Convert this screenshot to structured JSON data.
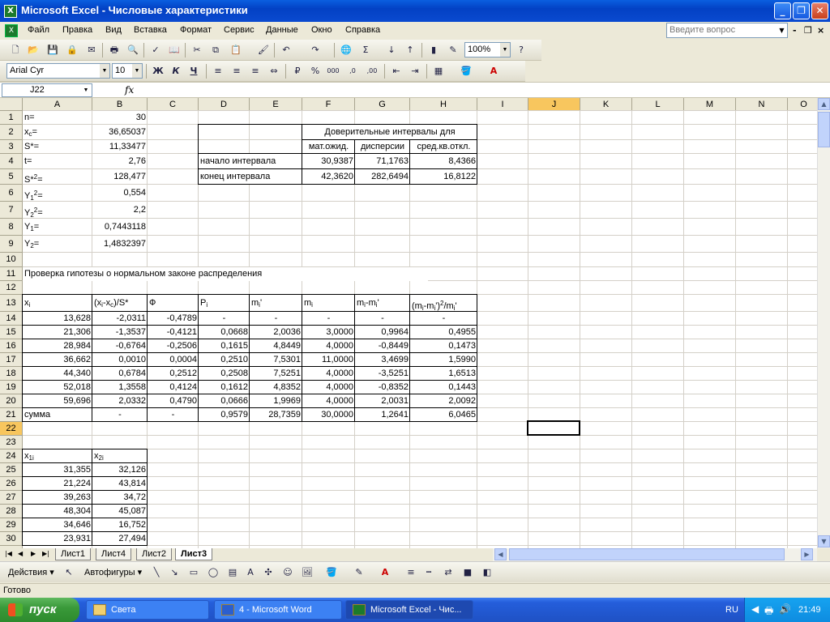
{
  "window": {
    "title": "Microsoft Excel - Числовые характеристики"
  },
  "menu": {
    "items": [
      "Файл",
      "Правка",
      "Вид",
      "Вставка",
      "Формат",
      "Сервис",
      "Данные",
      "Окно",
      "Справка"
    ],
    "ask_placeholder": "Введите вопрос"
  },
  "toolbar": {
    "zoom": "100%",
    "font": "Arial Cyr",
    "size": "10"
  },
  "formula": {
    "cell_ref": "J22",
    "fx": "fx"
  },
  "columns": [
    "A",
    "B",
    "C",
    "D",
    "E",
    "F",
    "G",
    "H",
    "I",
    "J",
    "K",
    "L",
    "M",
    "N",
    "O"
  ],
  "selected_col": "J",
  "selected_row": "22",
  "sheet": {
    "a1": "n=",
    "b1": "30",
    "a2": "x",
    "a2_sub": "c",
    "a2_end": "=",
    "b2": "36,65037",
    "a3": "S*=",
    "b3": "11,33477",
    "a4": "t=",
    "b4": "2,76",
    "a5": "S*",
    "a5_sup": "2",
    "a5_end": "=",
    "b5": "128,477",
    "a6": "Y",
    "a6_sub": "1",
    "a6_sup": "2",
    "a6_end": "=",
    "b6": "0,554",
    "a7": "Y",
    "a7_sub": "2",
    "a7_sup": "2",
    "a7_end": "=",
    "b7": "2,2",
    "a8": "Y",
    "a8_sub": "1",
    "a8_end": "=",
    "b8": "0,7443118",
    "a9": "Y",
    "a9_sub": "2",
    "a9_end": "=",
    "b9": "1,4832397",
    "a11": "Проверка гипотезы о нормальном законе распределения",
    "ci_title": "Доверительные интервалы для",
    "ci_headers": [
      "мат.ожид.",
      "дисперсии",
      "сред.кв.откл."
    ],
    "ci_rows": [
      {
        "label": "начало интервала",
        "values": [
          "30,9387",
          "71,1763",
          "8,4366"
        ]
      },
      {
        "label": "конец интервала",
        "values": [
          "42,3620",
          "282,6494",
          "16,8122"
        ]
      }
    ],
    "hyp_headers": {
      "a": "x",
      "a_sub": "i",
      "b1": "(x",
      "b_sub1": "i",
      "b2": "-x",
      "b_sub2": "c",
      "b3": ")/S*",
      "c": "Ф",
      "d": "P",
      "d_sub": "i",
      "e": "m",
      "e_sub": "i",
      "e_end": "'",
      "f": "m",
      "f_sub": "i",
      "g1": "m",
      "g_sub1": "i",
      "g2": "-m",
      "g_sub2": "i",
      "g3": "'",
      "h1": "(m",
      "h_sub1": "i",
      "h2": "-m",
      "h_sub2": "i",
      "h3": "')",
      "h_sup": "2",
      "h4": "/m",
      "h_sub3": "i",
      "h5": "'"
    },
    "hyp_rows": [
      [
        "13,628",
        "-2,0311",
        "-0,4789",
        "-",
        "-",
        "-",
        "-",
        "-"
      ],
      [
        "21,306",
        "-1,3537",
        "-0,4121",
        "0,0668",
        "2,0036",
        "3,0000",
        "0,9964",
        "0,4955"
      ],
      [
        "28,984",
        "-0,6764",
        "-0,2506",
        "0,1615",
        "4,8449",
        "4,0000",
        "-0,8449",
        "0,1473"
      ],
      [
        "36,662",
        "0,0010",
        "0,0004",
        "0,2510",
        "7,5301",
        "11,0000",
        "3,4699",
        "1,5990"
      ],
      [
        "44,340",
        "0,6784",
        "0,2512",
        "0,2508",
        "7,5251",
        "4,0000",
        "-3,5251",
        "1,6513"
      ],
      [
        "52,018",
        "1,3558",
        "0,4124",
        "0,1612",
        "4,8352",
        "4,0000",
        "-0,8352",
        "0,1443"
      ],
      [
        "59,696",
        "2,0332",
        "0,4790",
        "0,0666",
        "1,9969",
        "4,0000",
        "2,0031",
        "2,0092"
      ]
    ],
    "sum_row": [
      "сумма",
      "-",
      "-",
      "0,9579",
      "28,7359",
      "30,0000",
      "1,2641",
      "6,0465"
    ],
    "x_headers": {
      "a": "x",
      "a_sub": "1i",
      "b": "x",
      "b_sub": "2i"
    },
    "x_rows": [
      [
        "31,355",
        "32,126"
      ],
      [
        "21,224",
        "43,814"
      ],
      [
        "39,263",
        "34,72"
      ],
      [
        "48,304",
        "45,087"
      ],
      [
        "34,646",
        "16,752"
      ],
      [
        "23,931",
        "27,494"
      ]
    ]
  },
  "tabs": [
    "Лист1",
    "Лист4",
    "Лист2",
    "Лист3"
  ],
  "active_tab": "Лист3",
  "drawing": {
    "actions": "Действия",
    "autoshapes": "Автофигуры"
  },
  "status": "Готово",
  "taskbar": {
    "start": "пуск",
    "tasks": [
      "Света",
      "4 - Microsoft Word",
      "Microsoft Excel - Чис..."
    ],
    "lang": "RU",
    "clock": "21:49"
  },
  "colors": {
    "title_blue": "#0341c4",
    "selected_header": "#f8c65e",
    "taskbar_blue": "#245edb",
    "start_green": "#3a9a3a"
  }
}
